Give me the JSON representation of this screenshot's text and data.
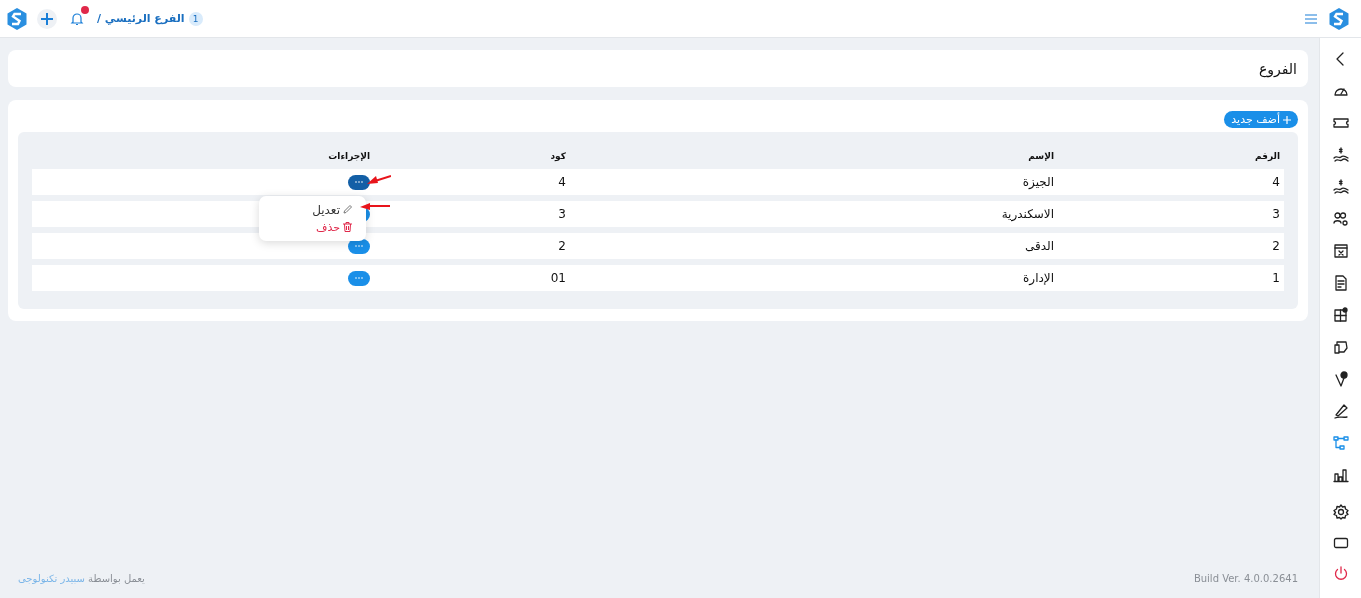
{
  "topbar": {
    "breadcrumb": {
      "count": "1",
      "label": "الفرع الرئيسي /"
    },
    "notifications": {
      "has_unread": true
    }
  },
  "sidebar": {
    "items": [
      {
        "kind": "collapse",
        "selected": false
      },
      {
        "kind": "dashboard",
        "selected": false
      },
      {
        "kind": "ticket",
        "selected": false
      },
      {
        "kind": "payment",
        "selected": false
      },
      {
        "kind": "payment",
        "selected": false
      },
      {
        "kind": "users",
        "selected": false
      },
      {
        "kind": "calendar",
        "selected": false
      },
      {
        "kind": "report",
        "selected": false
      },
      {
        "kind": "modules",
        "selected": false
      },
      {
        "kind": "device",
        "selected": false
      },
      {
        "kind": "location",
        "selected": false
      },
      {
        "kind": "signature",
        "selected": false
      },
      {
        "kind": "branches",
        "selected": true
      },
      {
        "kind": "chart",
        "selected": false
      },
      {
        "kind": "settings",
        "selected": false
      },
      {
        "kind": "screen",
        "selected": false
      },
      {
        "kind": "logout",
        "selected": false
      }
    ]
  },
  "page_title": "الفروع",
  "add_button": "أضف جديد",
  "table": {
    "columns": [
      "الرقم",
      "الإسم",
      "كود",
      "الإجراءات"
    ],
    "rows": [
      {
        "number": "4",
        "name": "الجيزة",
        "code": "4",
        "menu_open": true
      },
      {
        "number": "3",
        "name": "الاسكندرية",
        "code": "3",
        "menu_open": false
      },
      {
        "number": "2",
        "name": "الدقى",
        "code": "2",
        "menu_open": false
      },
      {
        "number": "1",
        "name": "الإدارة",
        "code": "01",
        "menu_open": false
      }
    ],
    "action_menu": [
      {
        "kind": "edit",
        "label": "تعديل"
      },
      {
        "kind": "delete",
        "label": "حذف"
      }
    ]
  },
  "footer": {
    "powered_by": "يعمل بواسطة",
    "company_link": "سبيدر تكنولوجى",
    "build": "Build Ver. 4.0.0.2641"
  }
}
